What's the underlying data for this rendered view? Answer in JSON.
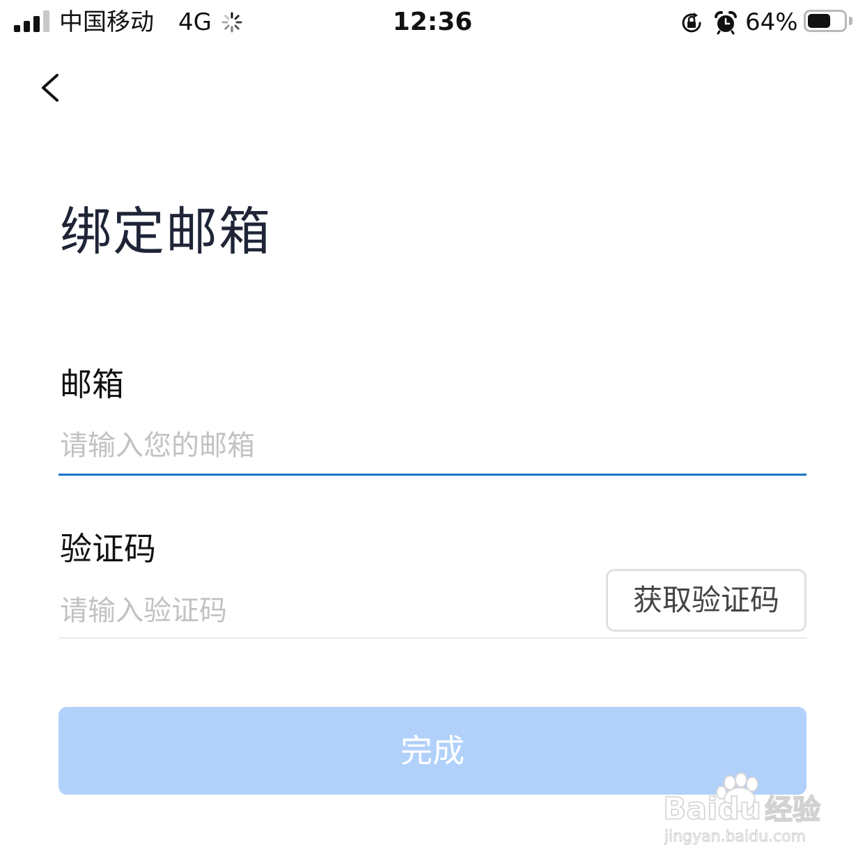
{
  "status_bar": {
    "carrier": "中国移动",
    "network": "4G",
    "time": "12:36",
    "battery_percent": "64%",
    "battery_level": 0.64
  },
  "nav": {
    "back_icon": "chevron-left-icon"
  },
  "page": {
    "title": "绑定邮箱"
  },
  "form": {
    "email": {
      "label": "邮箱",
      "value": "",
      "placeholder": "请输入您的邮箱"
    },
    "code": {
      "label": "验证码",
      "value": "",
      "placeholder": "请输入验证码",
      "get_code_label": "获取验证码"
    },
    "submit_label": "完成"
  },
  "watermark": {
    "brand": "Baidu",
    "brand_cn": "经验",
    "url": "jingyan.baidu.com"
  },
  "colors": {
    "title": "#1f2537",
    "focus_underline": "#1a73c9",
    "submit_disabled_bg": "#b1d1fb",
    "placeholder": "#c2c2c2"
  }
}
